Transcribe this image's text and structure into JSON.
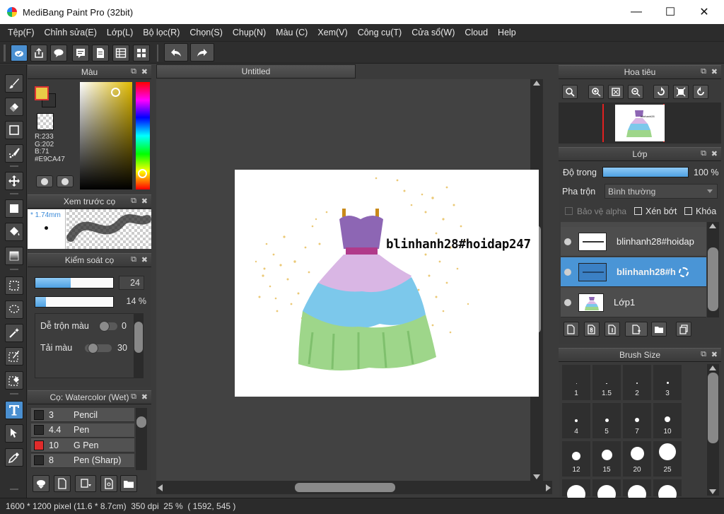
{
  "window": {
    "title": "MediBang Paint Pro (32bit)"
  },
  "menu": [
    "Tệp(F)",
    "Chỉnh sửa(E)",
    "Lớp(L)",
    "Bộ lọc(R)",
    "Chọn(S)",
    "Chụp(N)",
    "Màu (C)",
    "Xem(V)",
    "Công cụ(T)",
    "Cửa sổ(W)",
    "Cloud",
    "Help"
  ],
  "color_panel": {
    "title": "Màu",
    "r": "R:233",
    "g": "G:202",
    "b": "B:71",
    "hex": "#E9CA47",
    "fg_color": "#E9CA47"
  },
  "brush_preview": {
    "title": "Xem trước cọ",
    "size": "1.74mm"
  },
  "brush_control": {
    "title": "Kiểm soát cọ",
    "size_value": "24",
    "size_fraction": 0.45,
    "opacity_value": "14 %",
    "opacity_fraction": 0.14,
    "blend_label": "Dễ trộn màu",
    "blend_value": "0",
    "load_label": "Tải màu",
    "load_value": "30"
  },
  "brush_list": {
    "title": "Cọ: Watercolor (Wet)",
    "items": [
      {
        "size": "3",
        "name": "Pencil",
        "color": "#2a2a2a"
      },
      {
        "size": "4.4",
        "name": "Pen",
        "color": "#2a2a2a"
      },
      {
        "size": "10",
        "name": "G Pen",
        "color": "#e02b2b"
      },
      {
        "size": "8",
        "name": "Pen (Sharp)",
        "color": "#2a2a2a"
      }
    ]
  },
  "document": {
    "tab": "Untitled",
    "canvas_text": "blinhanh28#hoidap247"
  },
  "navigator": {
    "title": "Hoa tiêu"
  },
  "layers": {
    "title": "Lớp",
    "opacity_label": "Độ trong",
    "opacity_value": "100 %",
    "blend_label": "Pha trộn",
    "blend_mode": "Bình thường",
    "protect_alpha": "Bảo vệ alpha",
    "clipping": "Xén bớt",
    "lock": "Khóa",
    "items": [
      {
        "name": "blinhanh28#hoidap"
      },
      {
        "name": "blinhanh28#h"
      },
      {
        "name": "Lớp1"
      }
    ]
  },
  "brush_size": {
    "title": "Brush Size",
    "sizes": [
      "1",
      "1.5",
      "2",
      "3",
      "4",
      "5",
      "7",
      "10",
      "12",
      "15",
      "20",
      "25"
    ]
  },
  "status": {
    "pixels": "1600 * 1200 pixel",
    "cm": "(11.6 * 8.7cm)",
    "dpi": "350 dpi",
    "zoom": "25 %",
    "coords": "( 1592, 545 )"
  },
  "colors": {
    "accent": "#4a8fd0",
    "selected_layer": "#4a95d6"
  }
}
